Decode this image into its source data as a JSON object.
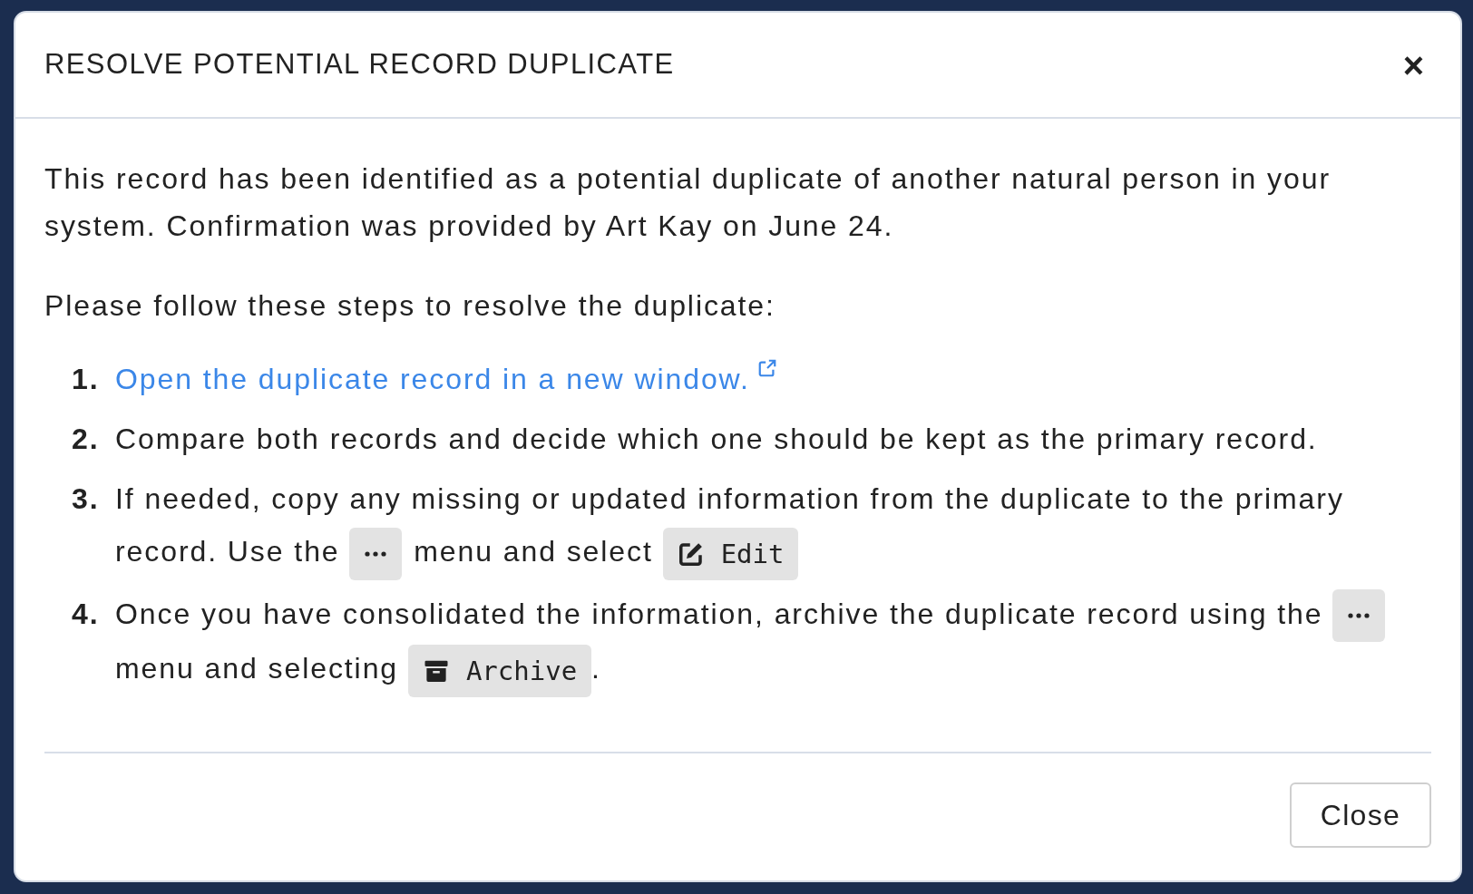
{
  "dialog": {
    "title": "RESOLVE POTENTIAL RECORD DUPLICATE",
    "close_icon": "×"
  },
  "intro": "This record has been identified as a potential duplicate of another natural person in your system. Confirmation was provided by Art Kay on June 24.",
  "steps_intro": "Please follow these steps to resolve the duplicate:",
  "steps": [
    {
      "number": "1.",
      "segments": [
        {
          "kind": "link",
          "text": "Open the duplicate record in a new window."
        }
      ]
    },
    {
      "number": "2.",
      "segments": [
        {
          "kind": "text",
          "text": "Compare both records and decide which one should be kept as the primary record."
        }
      ]
    },
    {
      "number": "3.",
      "segments": [
        {
          "kind": "text",
          "text": "If needed, copy any missing or updated information from the duplicate to the primary"
        },
        {
          "kind": "text",
          "text": "record. Use the"
        },
        {
          "kind": "menu"
        },
        {
          "kind": "text",
          "text": "menu and select"
        },
        {
          "kind": "edit",
          "text": "Edit"
        }
      ]
    },
    {
      "number": "4.",
      "segments": [
        {
          "kind": "text",
          "text": "Once you have consolidated the information, archive the duplicate record using the"
        },
        {
          "kind": "menu"
        },
        {
          "kind": "text",
          "text": "menu and selecting"
        },
        {
          "kind": "archive",
          "text": "Archive"
        },
        {
          "kind": "punct",
          "text": "."
        }
      ]
    }
  ],
  "buttons": [
    {
      "label": "Close"
    }
  ]
}
